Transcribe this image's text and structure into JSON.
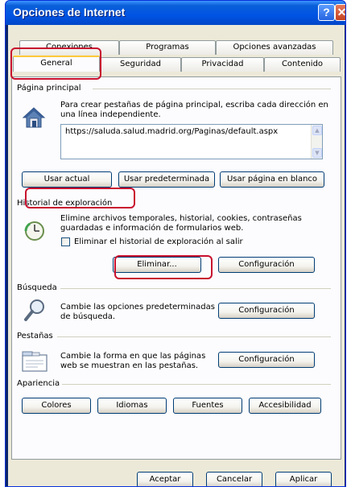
{
  "window": {
    "title": "Opciones de Internet",
    "help_glyph": "?",
    "close_glyph": "✕"
  },
  "tabs": {
    "row1": [
      {
        "label": "Conexiones"
      },
      {
        "label": "Programas"
      },
      {
        "label": "Opciones avanzadas"
      }
    ],
    "row2": [
      {
        "label": "General",
        "active": true
      },
      {
        "label": "Seguridad"
      },
      {
        "label": "Privacidad"
      },
      {
        "label": "Contenido"
      }
    ]
  },
  "home_page": {
    "group_title": "Página principal",
    "description": "Para crear pestañas de página principal, escriba cada dirección en una línea independiente.",
    "url": "https://saluda.salud.madrid.org/Paginas/default.aspx",
    "buttons": {
      "use_current": "Usar actual",
      "use_default": "Usar predeterminada",
      "use_blank": "Usar página en blanco"
    }
  },
  "browsing_history": {
    "group_title": "Historial de exploración",
    "description": "Elimine archivos temporales, historial, cookies, contraseñas guardadas e información de formularios web.",
    "checkbox_label": "Eliminar el historial de exploración al salir",
    "checkbox_checked": false,
    "buttons": {
      "delete": "Eliminar...",
      "settings": "Configuración"
    }
  },
  "search": {
    "group_title": "Búsqueda",
    "description": "Cambie las opciones predeterminadas de búsqueda.",
    "settings_button": "Configuración"
  },
  "tabs_section": {
    "group_title": "Pestañas",
    "description": "Cambie la forma en que las páginas web se muestran en las pestañas.",
    "settings_button": "Configuración"
  },
  "appearance": {
    "group_title": "Apariencia",
    "buttons": {
      "colors": "Colores",
      "languages": "Idiomas",
      "fonts": "Fuentes",
      "accessibility": "Accesibilidad"
    }
  },
  "dialog_buttons": {
    "ok": "Aceptar",
    "cancel": "Cancelar",
    "apply": "Aplicar"
  },
  "colors": {
    "highlight": "#c8102e",
    "titlebar": "#0054e3",
    "dialog_bg": "#ece9d8"
  },
  "icons": {
    "home": "house-icon",
    "history": "history-clock-icon",
    "search": "magnifier-icon",
    "tabs": "tabbed-window-icon"
  }
}
